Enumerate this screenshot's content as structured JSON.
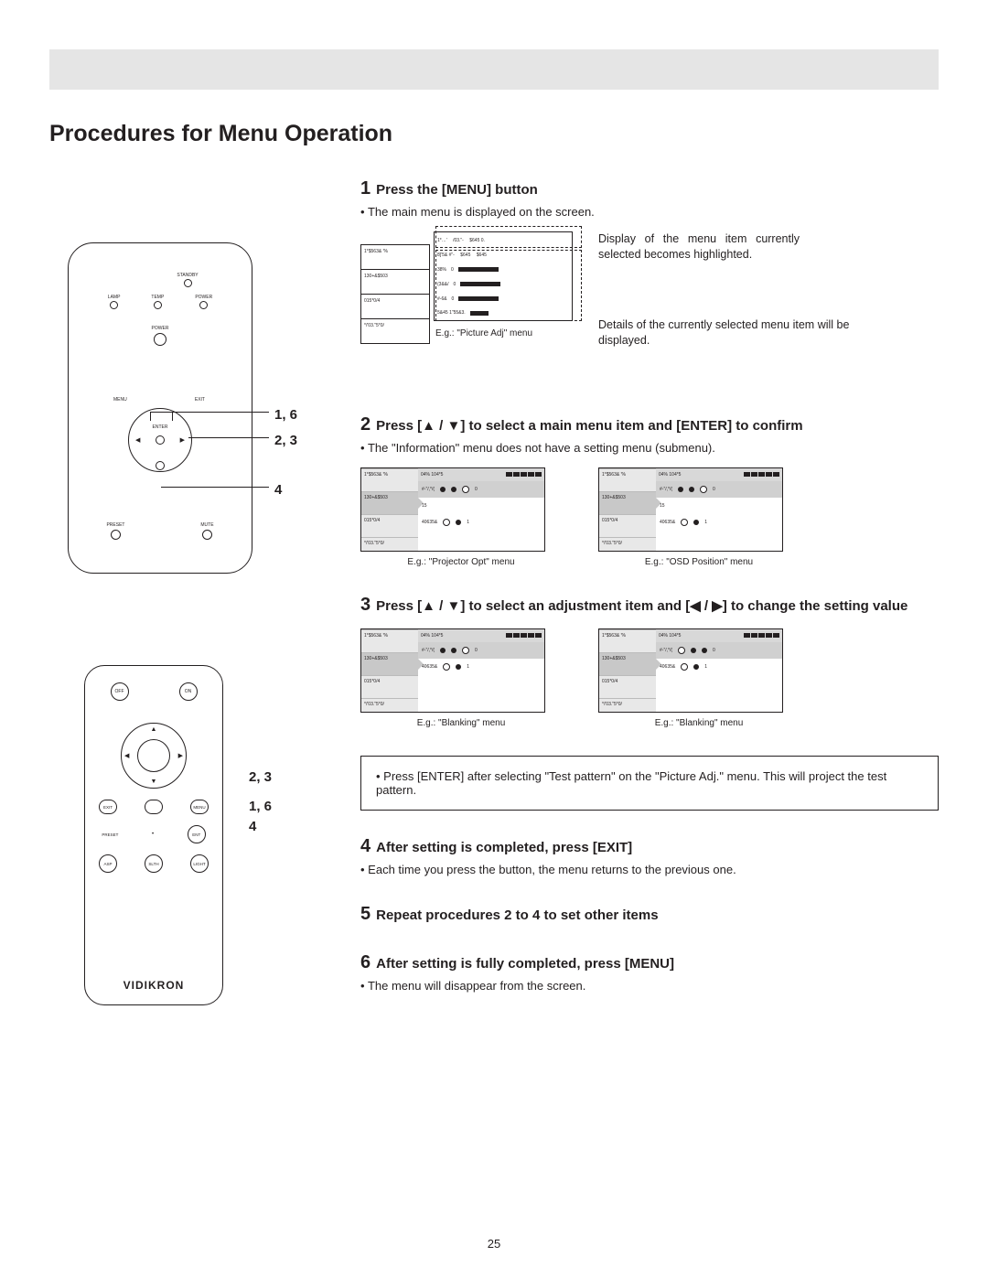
{
  "page": {
    "title": "Procedures for Menu Operation",
    "number": "25"
  },
  "steps": {
    "s1": {
      "num": "1",
      "title": "Press the [MENU] button",
      "bullet": "The main menu is displayed on the screen."
    },
    "s2": {
      "num": "2",
      "title": "Press [▲ / ▼] to select a main menu item and [ENTER] to confirm",
      "bullet": "The \"Information\" menu does not have a setting menu (submenu)."
    },
    "s3": {
      "num": "3",
      "title": "Press [▲ / ▼] to select an adjustment item and [◀ / ▶] to change the setting value"
    },
    "s4": {
      "num": "4",
      "title": "After setting is completed, press [EXIT]",
      "bullet": "Each time you press the button, the menu returns to the previous one."
    },
    "s5": {
      "num": "5",
      "title": "Repeat procedures 2 to 4 to set other items"
    },
    "s6": {
      "num": "6",
      "title": "After setting is fully completed, press [MENU]",
      "bullet": "The menu will disappear from the screen."
    }
  },
  "osd1": {
    "note1": "Display of the menu item currently selected becomes highlighted.",
    "note2": "Details of the currently selected menu item will be displayed.",
    "caption": "E.g.: \"Picture Adj\" menu",
    "sidebar": [
      "1*$563& '%",
      "130+&$503",
      "015*0/4",
      "*/'03.\"5*0/"
    ],
    "body_rows": [
      "1*…' 　/03.\"- 　$645 0.",
      "8]'5& #\"- 　$645 　$645",
      "38%　0",
      "(3&&/　0",
      "#-6&　0",
      "5&45 1\"55&3."
    ]
  },
  "osd_pair1": {
    "left_caption": "E.g.: \"Projector Opt\" menu",
    "right_caption": "E.g.: \"OSD Position\" menu",
    "sidebar": [
      "1*$563& '%",
      "130+&$503",
      "015*0/4",
      "*/'03.\"5*0/"
    ],
    "topbar": "04% 104*5",
    "rows": [
      "#-\"/,*/(",
      "15",
      "40635&"
    ]
  },
  "osd_pair2": {
    "left_caption": "E.g.: \"Blanking\" menu",
    "right_caption": "E.g.: \"Blanking\" menu",
    "sidebar": [
      "1*$563& '%",
      "130+&$503",
      "015*0/4",
      "*/'03.\"5*0/"
    ],
    "topbar": "04% 104*5",
    "rows": [
      "#-\"/,*/(",
      "40635&"
    ]
  },
  "note_box": "• Press [ENTER] after selecting \"Test pattern\" on the \"Picture Adj.\" menu. This will project the test pattern.",
  "remote1": {
    "leds_top": [
      "STANDBY"
    ],
    "leds_row": [
      "LAMP",
      "TEMP",
      "POWER"
    ],
    "power": "POWER",
    "dpad": {
      "menu": "MENU",
      "exit": "EXIT",
      "enter": "ENTER"
    },
    "bottom": [
      "PRESET",
      "MUTE"
    ],
    "callouts": {
      "c1": "1, 6",
      "c2": "2, 3",
      "c3": "4"
    }
  },
  "remote2": {
    "onoff": [
      "OFF",
      "ON"
    ],
    "row3": [
      "EXIT",
      "",
      "MENU"
    ],
    "row4_label": "PRESET",
    "row4_btn": "ENT",
    "row5": [
      "ASP",
      "SLTH",
      "LIGHT"
    ],
    "logo": "VIDIKRON",
    "callouts": {
      "c1": "2, 3",
      "c2": "1, 6",
      "c3": "4"
    }
  }
}
